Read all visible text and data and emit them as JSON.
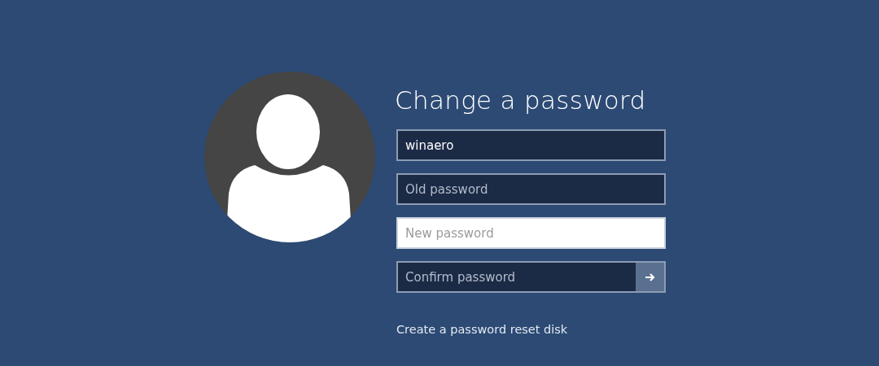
{
  "title": "Change a password",
  "fields": [
    {
      "kind": "text",
      "value": "winaero",
      "focused": false
    },
    {
      "kind": "text",
      "placeholder": "Old password",
      "focused": false
    },
    {
      "kind": "text",
      "placeholder": "New password",
      "focused": true
    },
    {
      "kind": "submit",
      "placeholder": "Confirm password",
      "focused": false
    }
  ],
  "link": "Create a password reset disk"
}
